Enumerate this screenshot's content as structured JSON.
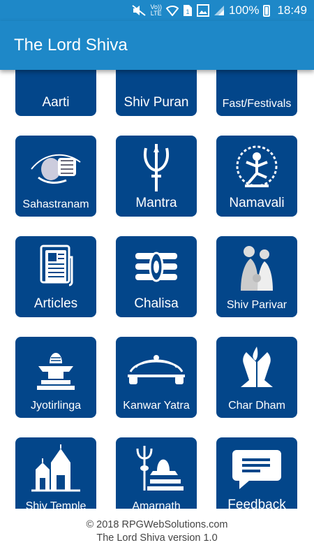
{
  "status_bar": {
    "battery": "100%",
    "time": "18:49"
  },
  "app_bar": {
    "title": "The Lord Shiva"
  },
  "tiles": [
    {
      "label": "Aarti",
      "icon": "lamp-icon"
    },
    {
      "label": "Shiv Puran",
      "icon": "sun-icon"
    },
    {
      "label": "Fast/Festivals",
      "icon": "festival-icon"
    },
    {
      "label": "Sahastranam",
      "icon": "damru-icon"
    },
    {
      "label": "Mantra",
      "icon": "trishul-icon"
    },
    {
      "label": "Namavali",
      "icon": "nataraja-icon"
    },
    {
      "label": "Articles",
      "icon": "newspaper-icon"
    },
    {
      "label": "Chalisa",
      "icon": "third-eye-icon"
    },
    {
      "label": "Shiv Parivar",
      "icon": "shiv-family-icon"
    },
    {
      "label": "Jyotirlinga",
      "icon": "lingam-icon"
    },
    {
      "label": "Kanwar Yatra",
      "icon": "kanwar-icon"
    },
    {
      "label": "Char Dham",
      "icon": "praying-hands-icon"
    },
    {
      "label": "Shiv Temple",
      "icon": "temple-icon"
    },
    {
      "label": "Amarnath",
      "icon": "amarnath-icon"
    },
    {
      "label": "Feedback",
      "icon": "chat-icon"
    }
  ],
  "footer": {
    "copyright": "© 2018 RPGWebSolutions.com",
    "version": "The Lord Shiva version 1.0"
  }
}
